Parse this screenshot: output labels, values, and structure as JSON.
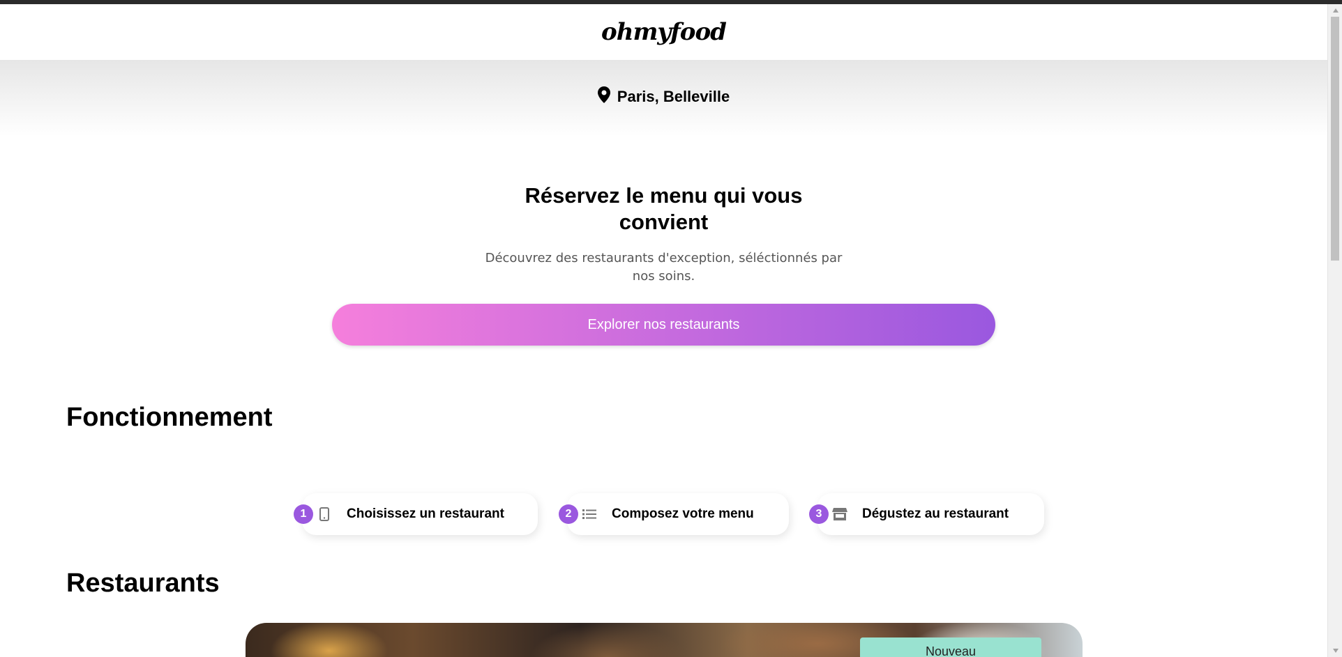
{
  "header": {
    "logo": "ohmyfood"
  },
  "location": {
    "icon": "map-pin-icon",
    "label": "Paris, Belleville"
  },
  "hero": {
    "title": "Réservez le menu qui vous convient",
    "subtitle": "Découvrez des restaurants d'exception, séléctionnés par nos soins.",
    "cta_label": "Explorer nos restaurants",
    "cta_gradient": [
      "#f57fdc",
      "#9a58df"
    ]
  },
  "how_it_works": {
    "title": "Fonctionnement",
    "steps": [
      {
        "number": "1",
        "icon": "phone-icon",
        "label": "Choisissez un restaurant"
      },
      {
        "number": "2",
        "icon": "list-icon",
        "label": "Composez votre menu"
      },
      {
        "number": "3",
        "icon": "store-icon",
        "label": "Dégustez au restaurant"
      }
    ],
    "accent_color": "#9a58df"
  },
  "restaurants": {
    "title": "Restaurants",
    "first_card_badge": "Nouveau",
    "badge_color": "#99e2d0"
  }
}
